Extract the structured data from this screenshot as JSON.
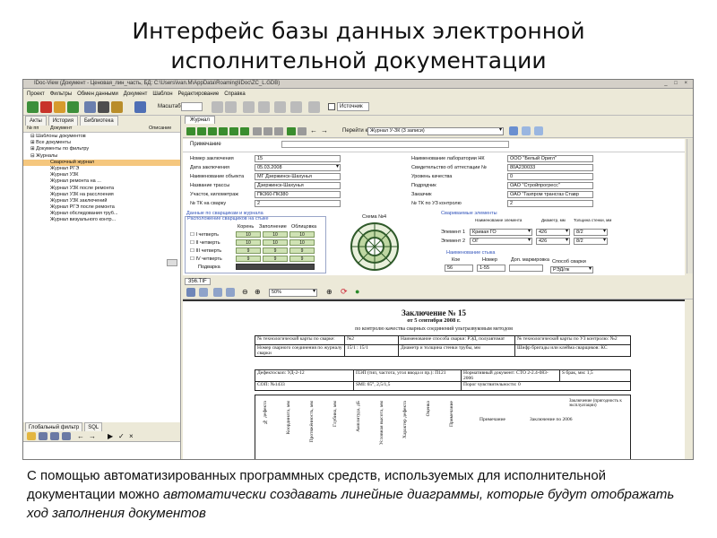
{
  "slide": {
    "title_line1": "Интерфейс базы данных электронной",
    "title_line2": "исполнительной документации",
    "caption_lead": "С помощью автоматизированных программных средств, используемых для исполнительной документации можно ",
    "caption_italic": "автоматически создавать линейные диаграммы, которые будут отображать ход заполнения документов"
  },
  "window": {
    "title": "IDoc-View (Документ - Ценовая_лин_часть, БД: C:\\Users\\ivan.M\\AppData\\Roaming\\IDoc\\ZC_L.GDB)",
    "controls": "_ □ ×"
  },
  "menu": [
    "Проект",
    "Фильтры",
    "Обмен данными",
    "Документ",
    "Шаблон",
    "Редактирование",
    "Справка"
  ],
  "toolbar": {
    "scale_label": "Масштаб",
    "version_label": "Источник"
  },
  "left": {
    "tabs": [
      "Акты",
      "История",
      "Библиотека"
    ],
    "cols": [
      "№ пп",
      "Документ",
      "Описание"
    ],
    "tree": [
      "Шаблоны документов",
      "Все документы",
      "Документы по фильтру",
      "Журналы",
      "Сварочный журнал",
      "Журнал РГЭ",
      "Журнал УЗК",
      "Журнал ремонта на ...",
      "Журнал УЗК после ремонта",
      "Журнал УЗК на расслоения",
      "Журнал УЗК заключений",
      "Журнал РГЭ после ремонта",
      "Журнал обследования труб...",
      "Журнал визуального контр..."
    ],
    "filter_tabs": [
      "Глобальный фильтр",
      "SQL"
    ]
  },
  "journal": {
    "tab": "Журнал",
    "goto_label": "Перейти к",
    "goto_value": "Журнал У-ЗК (3 записи)",
    "note_label": "Примечание",
    "left_fields": [
      {
        "label": "Номер заключения",
        "value": "15"
      },
      {
        "label": "Дата заключения",
        "value": "05.03.2008"
      },
      {
        "label": "Наименование объекта",
        "value": "МГ Дзержинск-Шахунья"
      },
      {
        "label": "Название трассы",
        "value": "Дзержинск-Шахунья"
      },
      {
        "label": "Участок, километраж",
        "value": "ПК360-ПК380"
      },
      {
        "label": "№ ТК на сварку",
        "value": "2"
      }
    ],
    "right_fields": [
      {
        "label": "Наименование лаборатории НК",
        "value": "ООО \"Белый Оригл\""
      },
      {
        "label": "Свидетельство об аттестации №",
        "value": "80А230033"
      },
      {
        "label": "Уровень качества",
        "value": "0"
      },
      {
        "label": "Подрядчик",
        "value": "ОАО \"Стройпрогресс\""
      },
      {
        "label": "Заказчик",
        "value": "ОАО \"Газпром трансгаз Ставр"
      },
      {
        "label": "№ ТК по УЗ контролю",
        "value": "2"
      }
    ],
    "welder_section": "Данные по сварщикам и журнала",
    "welder_sub": "Расположение сварщиков на стыке",
    "welder_hdr": [
      "Корень",
      "Заполнение",
      "Облицовка"
    ],
    "quarters": [
      "I четверть",
      "II четверть",
      "III четверть",
      "IV четверть",
      "Подварка"
    ],
    "welder_vals": [
      [
        "10",
        "10",
        "10"
      ],
      [
        "10",
        "10",
        "10"
      ],
      [
        "9",
        "9",
        "9"
      ],
      [
        "9",
        "9",
        "9"
      ]
    ],
    "scheme_label": "Схема №4",
    "elements_title": "Свариваемые элементы",
    "elements_hdr": [
      "Наименование элемента",
      "Диаметр, мм",
      "Толщина стенки, мм"
    ],
    "elements": [
      {
        "label": "Элемент 1",
        "name": "Кривая ГО",
        "d": "426",
        "t": "8/2"
      },
      {
        "label": "Элемент 2",
        "name": "ОГ",
        "d": "426",
        "t": "8/2"
      }
    ],
    "seam_title": "Наименование стыка",
    "seam_hdr": [
      "Кое",
      "Номер",
      "Доп. маркировка"
    ],
    "seam_vals": [
      "56",
      "1-55",
      ""
    ],
    "weld_method_label": "Способ сварки",
    "weld_method_value": "РЭД/лк"
  },
  "image": {
    "file": "356.TIF",
    "zoom": "50%"
  },
  "document": {
    "title": "Заключение № 15",
    "date_line": "от 5 сентября 2008 г.",
    "subtitle": "по контролю качества сварных соединений ультразвуковым методом",
    "row1": [
      "№ технологической карты по сварке:",
      "№2",
      "Наименование способа сварки: РЭД, полуавтомат",
      "№ технологической карты по УЗ контролю: №2"
    ],
    "row2": [
      "Номер сварного соединения по журналу сварки",
      "15/1 : 15/1",
      "Диаметр и толщина стенки трубы, мм",
      "Шифр бригады или клейма сварщиков: КС"
    ],
    "row3": [
      "Дефектоскоп: УД-2-12",
      "ПЭП (тип, частота, угол ввода и пр.): П121",
      "Нормативный документ: СТО 2-2.4-083-2006",
      "S брак, мм: 1,5"
    ],
    "row4": [
      "СОП: №1433",
      "SMI: 65°, 2,5/1,5",
      "Порог чувствительности: 0"
    ],
    "vcols": [
      "№ дефекта",
      "Координата, мм",
      "Протяжённость, мм",
      "Глубина, мм",
      "Амплитуда, дБ",
      "Условная высота, мм",
      "Характер дефекта",
      "Оценка",
      "Примечание"
    ],
    "col_prim": "Примечание",
    "col_konl": "Заключение по 2006",
    "col_last": "Заключение (пригодность к эксплуатации)"
  }
}
